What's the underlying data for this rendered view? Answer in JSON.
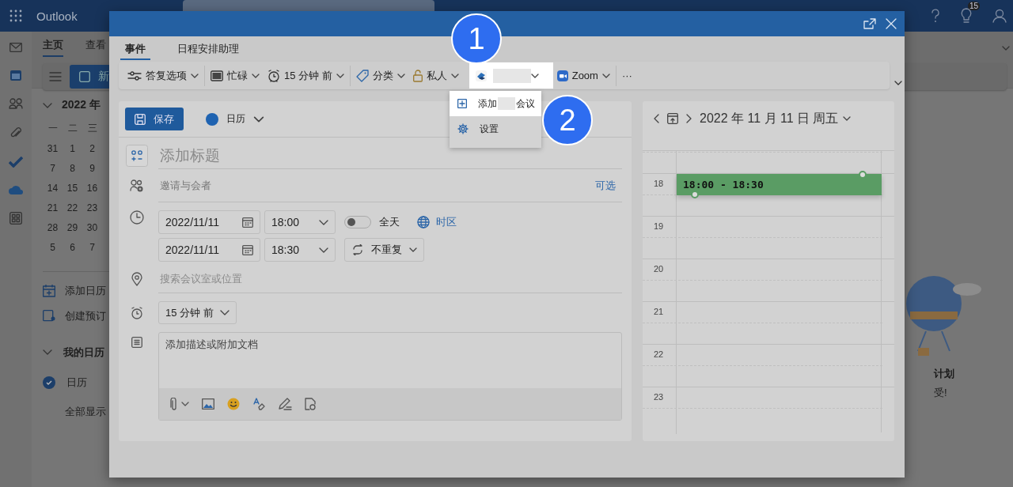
{
  "app": {
    "title": "Outlook",
    "tip_count": "15"
  },
  "ribbon": {
    "tabs": [
      {
        "label": "主页",
        "selected": true
      },
      {
        "label": "查看",
        "selected": false
      }
    ],
    "new_button": "新"
  },
  "mini_calendar": {
    "title": "2022 年",
    "weekdays": [
      "一",
      "二",
      "三"
    ],
    "weeks": [
      [
        "31",
        "1",
        "2"
      ],
      [
        "7",
        "8",
        "9"
      ],
      [
        "14",
        "15",
        "16"
      ],
      [
        "21",
        "22",
        "23"
      ],
      [
        "28",
        "29",
        "30"
      ],
      [
        "5",
        "6",
        "7"
      ]
    ]
  },
  "sidebar": {
    "actions": [
      {
        "kind": "add",
        "label": "添加日历"
      },
      {
        "kind": "booking",
        "label": "创建预订"
      }
    ],
    "group": {
      "title": "我的日历",
      "expanded": true,
      "calendars": [
        {
          "label": "日历",
          "checked": true
        }
      ]
    },
    "show_all": "全部显示"
  },
  "notice": {
    "title": "计划",
    "text": "受!"
  },
  "dialog": {
    "tabs": [
      {
        "label": "事件",
        "selected": true
      },
      {
        "label": "日程安排助理",
        "selected": false
      }
    ],
    "toolbar": [
      {
        "kind": "reply",
        "label": "答复选项"
      },
      {
        "kind": "busy",
        "label": "忙碌"
      },
      {
        "kind": "reminder",
        "label": "15 分钟 前"
      },
      {
        "kind": "category",
        "label": "分类"
      },
      {
        "kind": "private",
        "label": "私人"
      },
      {
        "kind": "addin",
        "highlighted": true
      },
      {
        "kind": "zoom",
        "label": "Zoom"
      },
      {
        "kind": "more",
        "label": "···"
      }
    ],
    "menu": [
      {
        "kind": "add",
        "label_start": "添加",
        "label_end": "会议",
        "selected": true
      },
      {
        "kind": "settings",
        "label": "设置",
        "selected": false
      }
    ],
    "steps": [
      "1",
      "2"
    ],
    "form": {
      "save": "保存",
      "calendar": {
        "label": "日历",
        "color": "#1f63b1"
      },
      "title_placeholder": "添加标题",
      "attendees_placeholder": "邀请与会者",
      "optional": "可选",
      "start": {
        "date": "2022/11/11",
        "time": "18:00"
      },
      "end": {
        "date": "2022/11/11",
        "time": "18:30"
      },
      "all_day": {
        "label": "全天",
        "on": false
      },
      "timezone": "时区",
      "repeat": "不重复",
      "location_placeholder": "搜索会议室或位置",
      "reminder": "15 分钟 前",
      "description_placeholder": "添加描述或附加文档"
    },
    "day_view": {
      "title": "2022 年 11 月 11 日 周五",
      "hours": [
        {
          "label": "18",
          "event": "18:00 - 18:30"
        },
        {
          "label": "19"
        },
        {
          "label": "20"
        },
        {
          "label": "21"
        },
        {
          "label": "22"
        },
        {
          "label": "23"
        }
      ]
    }
  }
}
